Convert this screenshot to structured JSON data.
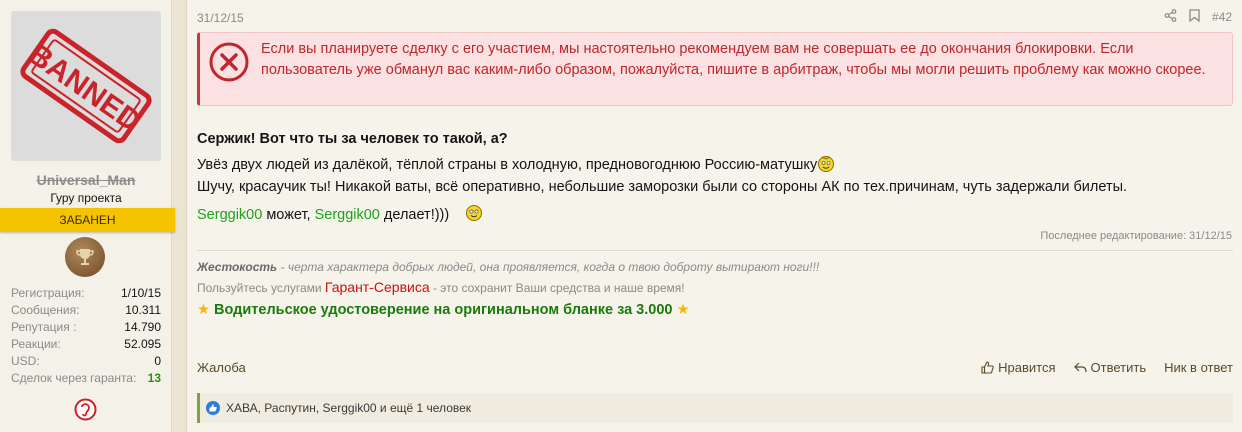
{
  "user": {
    "username": "Universal_Man",
    "title": "Гуру проекта",
    "banner": "ЗАБАНЕН",
    "avatar_stamp": "BANNED",
    "stats": [
      {
        "label": "Регистрация:",
        "value": "1/10/15"
      },
      {
        "label": "Сообщения:",
        "value": "10.311"
      },
      {
        "label": "Репутация :",
        "value": "14.790"
      },
      {
        "label": "Реакции:",
        "value": "52.095"
      },
      {
        "label": "USD:",
        "value": "0"
      },
      {
        "label": "Сделок через гаранта:",
        "value": "13"
      }
    ]
  },
  "post": {
    "date": "31/12/15",
    "number": "#42",
    "alert": "Если вы планируете сделку с его участием, мы настоятельно рекомендуем вам не совершать ее до окончания блокировки. Если пользователь уже обманул вас каким-либо образом, пожалуйста, пишите в арбитраж, чтобы мы могли решить проблему как можно скорее.",
    "line1": "Сержик! Вот что ты за человек то такой, а?",
    "line2": "Увёз двух людей из далёкой, тёплой страны в холодную, предновогоднюю Россию-матушку",
    "line3": "Шучу, красаучик ты! Никакой ваты, всё оперативно, небольшие заморозки были со стороны АК по тех.причинам, чуть задержали билеты.",
    "line4": {
      "mention1": "Serggik00",
      "text1": " может, ",
      "mention2": "Serggik00",
      "text2": " делает!)))"
    },
    "edited": "Последнее редактирование: 31/12/15"
  },
  "signature": {
    "quote_bold": "Жестокость",
    "quote_rest": " - черта характера добрых людей, она проявляется, когда о твою доброту вытирают ноги!!!",
    "service_prefix": "Пользуйтесь услугами ",
    "service_name": "Гарант-Сервиса",
    "service_suffix": " - это сохранит Ваши средства и наше время!",
    "promo": "Водительское удостоверение на оригинальном бланке за 3.000"
  },
  "footer": {
    "report": "Жалоба",
    "like": "Нравится",
    "reply": "Ответить",
    "nick": "Ник в ответ"
  },
  "reactions": {
    "text": "ХАВА, Распутин, Serggik00 и ещё 1 человек"
  },
  "colors": {
    "alert_red": "#c0262b",
    "banned_yellow": "#f5c300",
    "mention_green": "#1aa41a",
    "promo_green": "#1a7a0c"
  }
}
